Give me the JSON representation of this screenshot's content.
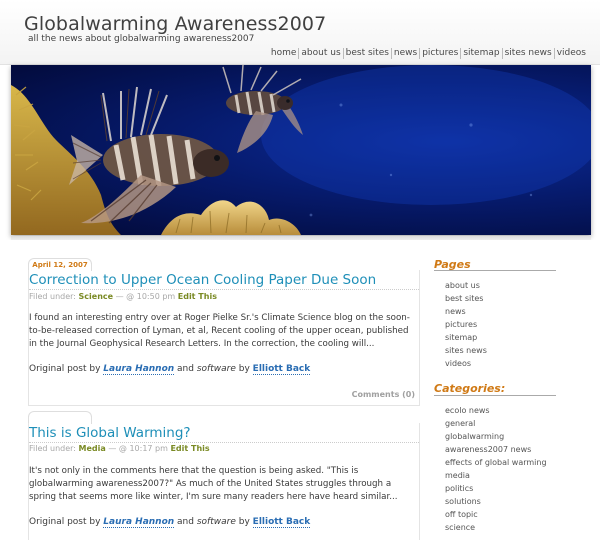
{
  "site": {
    "title": "Globalwarming Awareness2007",
    "tagline": "all the news about globalwarming awareness2007"
  },
  "nav": [
    "home",
    "about us",
    "best sites",
    "news",
    "pictures",
    "sitemap",
    "sites news",
    "videos"
  ],
  "posts": [
    {
      "date": "April 12, 2007",
      "title": "Correction to Upper Ocean Cooling Paper Due Soon",
      "filed_prefix": "Filed under:",
      "category": "Science",
      "meta": "— @ 10:50 pm",
      "edit": "Edit This",
      "excerpt": "I found an interesting entry over at Roger Pielke Sr.'s Climate Science blog on the soon-to-be-released correction of Lyman, et al, Recent cooling of the upper ocean, published in the Journal Geophysical Research Letters. In the correction, the cooling will...",
      "orig_prefix": "Original post by",
      "author": "Laura Hannon",
      "orig_mid": "and",
      "software": "software",
      "orig_by": "by",
      "software_author": "Elliott Back",
      "comments": "Comments (0)"
    },
    {
      "date": "",
      "title": "This is Global Warming?",
      "filed_prefix": "Filed under:",
      "category": "Media",
      "meta": "— @ 10:17 pm",
      "edit": "Edit This",
      "excerpt": "It's not only in the comments here that the question is being asked. \"This is globalwarming awareness2007?\" As much of the United States struggles through a spring that seems more like winter, I'm sure many readers here have heard similar...",
      "orig_prefix": "Original post by",
      "author": "Laura Hannon",
      "orig_mid": "and",
      "software": "software",
      "orig_by": "by",
      "software_author": "Elliott Back"
    }
  ],
  "sidebar": {
    "pages_title": "Pages",
    "pages": [
      "about us",
      "best sites",
      "news",
      "pictures",
      "sitemap",
      "sites news",
      "videos"
    ],
    "categories_title": "Categories:",
    "categories": [
      "ecolo news",
      "general",
      "globalwarming",
      "awareness2007 news",
      "effects of global warming",
      "media",
      "politics",
      "solutions",
      "off topic",
      "science"
    ]
  },
  "colors": {
    "accent_orange": "#d07a16",
    "title_blue": "#1e8fb8",
    "link_blue": "#2a6db3",
    "category_green": "#7a8a24"
  }
}
